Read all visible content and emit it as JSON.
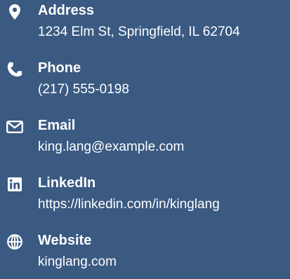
{
  "background_color": "#3a5a82",
  "text_color": "#ffffff",
  "contacts": [
    {
      "icon": "map-pin-icon",
      "label": "Address",
      "value": "1234 Elm St, Springfield, IL 62704"
    },
    {
      "icon": "phone-icon",
      "label": "Phone",
      "value": "(217) 555-0198"
    },
    {
      "icon": "envelope-icon",
      "label": "Email",
      "value": "king.lang@example.com"
    },
    {
      "icon": "linkedin-icon",
      "label": "LinkedIn",
      "value": "https://linkedin.com/in/kinglang"
    },
    {
      "icon": "globe-icon",
      "label": "Website",
      "value": "kinglang.com"
    }
  ]
}
